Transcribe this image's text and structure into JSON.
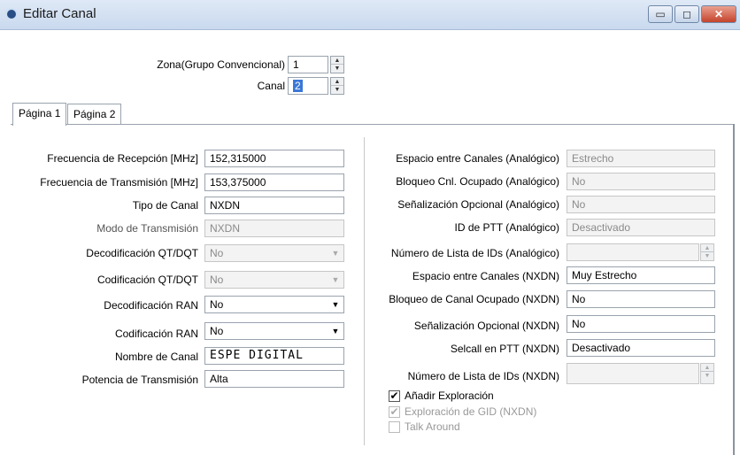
{
  "window": {
    "title": "Editar Canal",
    "title_icon": "radio-icon",
    "controls": {
      "minimize": "▭",
      "maximize": "◻",
      "close": "✕"
    }
  },
  "header": {
    "zona_label": "Zona(Grupo Convencional)",
    "zona_value": "1",
    "canal_label": "Canal",
    "canal_value": "2"
  },
  "tabs": [
    {
      "label": "Página 1"
    },
    {
      "label": "Página 2"
    }
  ],
  "left": {
    "rx_freq": {
      "label": "Frecuencia de Recepción [MHz]",
      "value": "152,315000"
    },
    "tx_freq": {
      "label": "Frecuencia de Transmisión [MHz]",
      "value": "153,375000"
    },
    "channel_type": {
      "label": "Tipo de Canal",
      "value": "NXDN"
    },
    "tx_mode": {
      "label": "Modo de Transmisión",
      "value": "NXDN"
    },
    "qt_decode": {
      "label": "Decodificación QT/DQT",
      "value": "No"
    },
    "qt_encode": {
      "label": "Codificación QT/DQT",
      "value": "No"
    },
    "ran_decode": {
      "label": "Decodificación RAN",
      "value": "No"
    },
    "ran_encode": {
      "label": "Codificación RAN",
      "value": "No"
    },
    "channel_name": {
      "label": "Nombre de Canal",
      "value": "ESPE DIGITAL"
    },
    "tx_power": {
      "label": "Potencia de Transmisión",
      "value": "Alta"
    }
  },
  "right": {
    "spacing_analog": {
      "label": "Espacio entre Canales (Analógico)",
      "value": "Estrecho"
    },
    "busy_lock_analog": {
      "label": "Bloqueo Cnl. Ocupado (Analógico)",
      "value": "No"
    },
    "opt_signal_analog": {
      "label": "Señalización Opcional (Analógico)",
      "value": "No"
    },
    "ptt_id_analog": {
      "label": "ID de PTT (Analógico)",
      "value": "Desactivado"
    },
    "id_list_analog": {
      "label": "Número de Lista de IDs (Analógico)",
      "value": ""
    },
    "spacing_nxdn": {
      "label": "Espacio entre Canales (NXDN)",
      "value": "Muy Estrecho"
    },
    "busy_lock_nxdn": {
      "label": "Bloqueo de Canal Ocupado (NXDN)",
      "value": "No"
    },
    "opt_signal_nxdn": {
      "label": "Señalización Opcional (NXDN)",
      "value": "No"
    },
    "selcall_ptt_nxdn": {
      "label": "Selcall en PTT (NXDN)",
      "value": "Desactivado"
    },
    "id_list_nxdn": {
      "label": "Número de Lista de IDs (NXDN)",
      "value": ""
    }
  },
  "checkboxes": {
    "add_scan": {
      "label": "Añadir Exploración",
      "checked": true
    },
    "gid_scan": {
      "label": "Exploración de GID (NXDN)",
      "checked": true
    },
    "talk_around": {
      "label": "Talk Around",
      "checked": false
    }
  },
  "glyphs": {
    "check": "✔",
    "dropdown": "▼",
    "spin_up": "▲",
    "spin_down": "▼"
  }
}
